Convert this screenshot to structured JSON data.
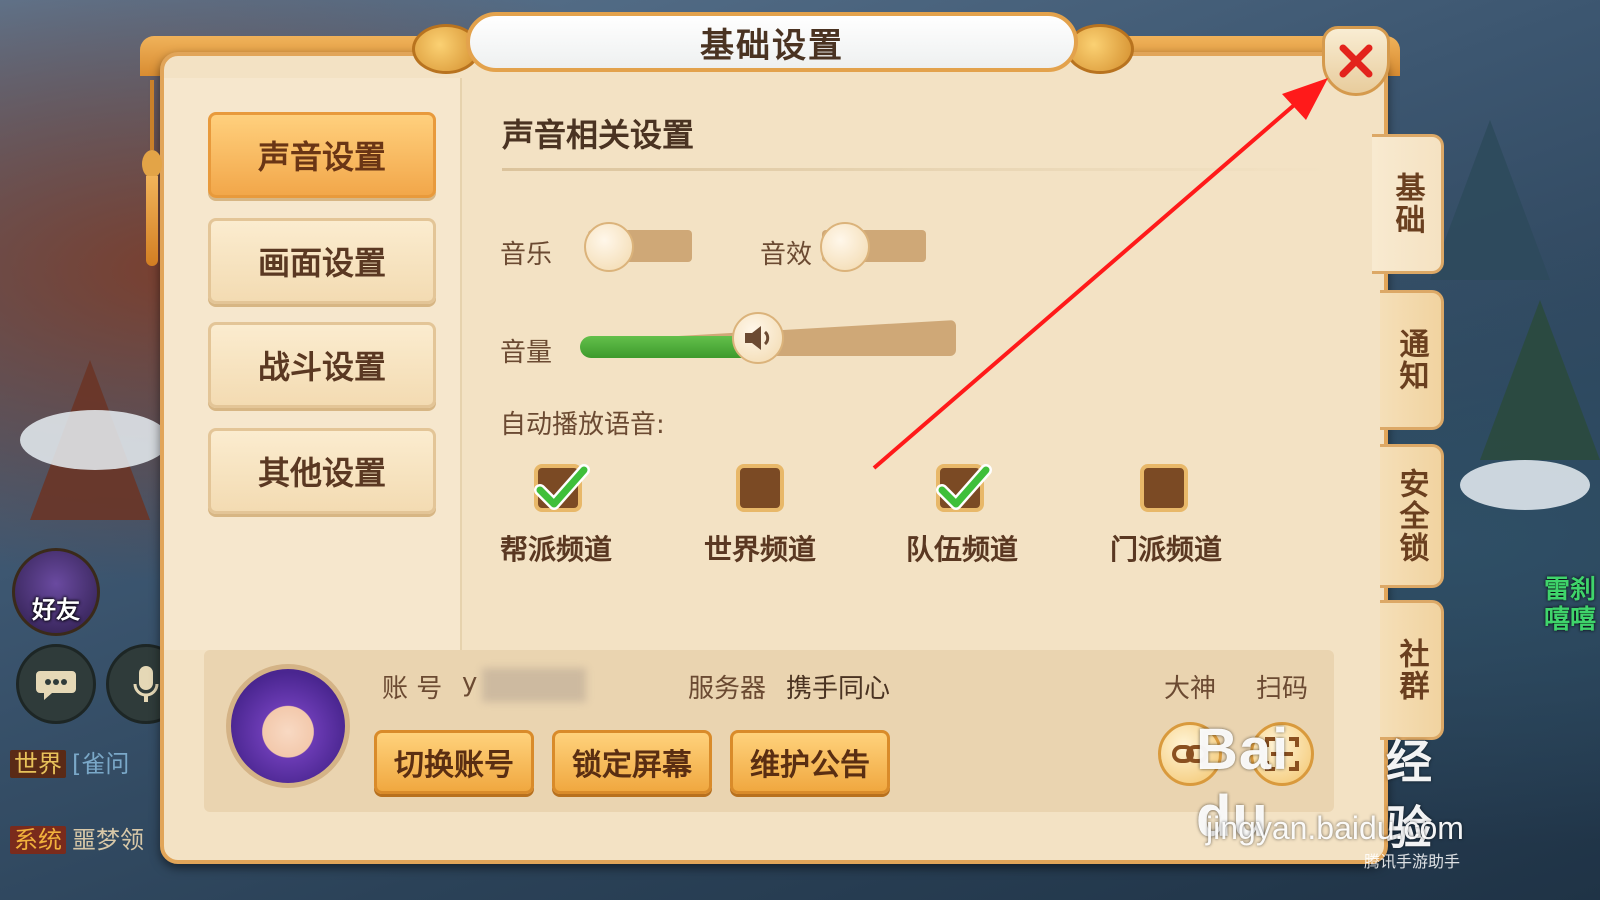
{
  "window": {
    "title": "基础设置"
  },
  "sidebar": {
    "items": [
      {
        "label": "声音设置",
        "active": true
      },
      {
        "label": "画面设置",
        "active": false
      },
      {
        "label": "战斗设置",
        "active": false
      },
      {
        "label": "其他设置",
        "active": false
      }
    ]
  },
  "sound": {
    "section_title": "声音相关设置",
    "music_label": "音乐",
    "music_on": false,
    "effects_label": "音效",
    "effects_on": false,
    "volume_label": "音量",
    "volume_level": 0.47,
    "auto_play_label": "自动播放语音:",
    "channels": [
      {
        "label": "帮派频道",
        "checked": true
      },
      {
        "label": "世界频道",
        "checked": false
      },
      {
        "label": "队伍频道",
        "checked": true
      },
      {
        "label": "门派频道",
        "checked": false
      }
    ]
  },
  "account": {
    "account_label": "账 号",
    "account_value": "y",
    "server_label": "服务器",
    "server_value": "携手同心",
    "dashen_label": "大神",
    "scan_label": "扫码",
    "buttons": [
      "切换账号",
      "锁定屏幕",
      "维护公告"
    ]
  },
  "side_tabs": [
    {
      "label": "基础",
      "active": true
    },
    {
      "label": "通知",
      "active": false
    },
    {
      "label": "安全锁",
      "active": false
    },
    {
      "label": "社群",
      "active": false
    }
  ],
  "hud": {
    "friend_label": "好友",
    "chat": [
      {
        "tag": "世界",
        "text": "[雀问"
      },
      {
        "tag": "系统",
        "text": "噩梦领"
      }
    ],
    "right_names": [
      "雷刹",
      "嘻嘻"
    ]
  },
  "watermark": {
    "logo": "Bai du",
    "cn": "经验",
    "url": "jingyan.baidu.com",
    "small": "腾讯手游助手"
  },
  "colors": {
    "panel_bg": "#f3e2c4",
    "accent_orange": "#f2a74a",
    "check_green": "#3fbf3a",
    "slider_green": "#4aa83a",
    "close_red": "#e3231c",
    "annotation_red": "#ff1a1a"
  }
}
